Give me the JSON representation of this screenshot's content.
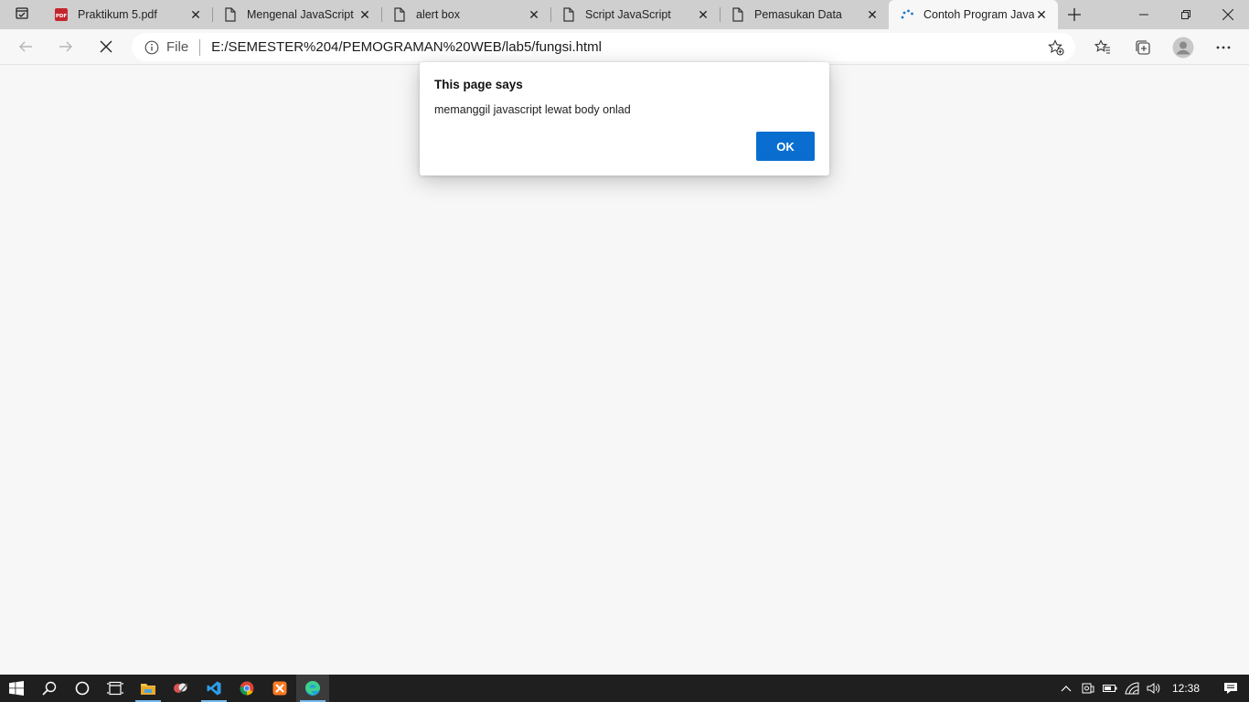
{
  "browser": {
    "tabs": [
      {
        "title": "Praktikum 5.pdf",
        "icon": "pdf-icon"
      },
      {
        "title": "Mengenal JavaScript",
        "icon": "page-icon"
      },
      {
        "title": "alert box",
        "icon": "page-icon"
      },
      {
        "title": "Script JavaScript",
        "icon": "page-icon"
      },
      {
        "title": "Pemasukan Data",
        "icon": "page-icon"
      },
      {
        "title": "Contoh Program JavaScript",
        "icon": "loading-icon",
        "active": true
      }
    ],
    "address": {
      "scheme": "File",
      "url": "E:/SEMESTER%204/PEMOGRAMAN%20WEB/lab5/fungsi.html"
    }
  },
  "dialog": {
    "title": "This page says",
    "message": "memanggil javascript lewat body onlad",
    "ok_label": "OK"
  },
  "taskbar": {
    "apps": [
      "windows-start-icon",
      "search-icon",
      "cortana-icon",
      "task-view-icon",
      "file-explorer-icon",
      "snipping-icon",
      "vscode-icon",
      "chrome-icon",
      "xampp-icon",
      "edge-icon"
    ],
    "time": "12:38"
  },
  "colors": {
    "accent": "#0a6ed1",
    "tabstrip": "#cfcfcf",
    "page_bg": "#f7f7f7",
    "taskbar": "#1f1f1f"
  }
}
